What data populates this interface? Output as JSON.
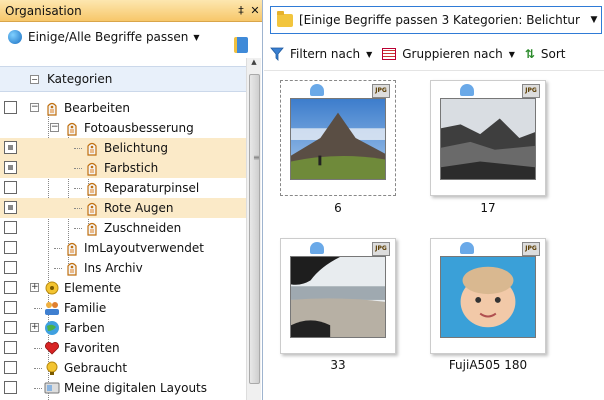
{
  "left_panel": {
    "title": "Organisation",
    "pin_glyph": "‡",
    "close_glyph": "✕",
    "filter_label": "Einige/Alle Begriffe passen",
    "section_header": "Kategorien",
    "tree": [
      {
        "label": "Bearbeiten",
        "checkbox": "unchecked",
        "highlight": false,
        "icon": "category-tag-icon"
      },
      {
        "label": "Fotoausbesserung",
        "checkbox": "none",
        "highlight": false,
        "icon": "category-tag-icon"
      },
      {
        "label": "Belichtung",
        "checkbox": "mixed",
        "highlight": true,
        "icon": "category-tag-icon"
      },
      {
        "label": "Farbstich",
        "checkbox": "mixed",
        "highlight": true,
        "icon": "category-tag-icon"
      },
      {
        "label": "Reparaturpinsel",
        "checkbox": "unchecked",
        "highlight": false,
        "icon": "category-tag-icon"
      },
      {
        "label": "Rote Augen",
        "checkbox": "mixed",
        "highlight": true,
        "icon": "category-tag-icon"
      },
      {
        "label": "Zuschneiden",
        "checkbox": "unchecked",
        "highlight": false,
        "icon": "category-tag-icon"
      },
      {
        "label": "ImLayoutverwendet",
        "checkbox": "unchecked",
        "highlight": false,
        "icon": "category-tag-icon"
      },
      {
        "label": "Ins Archiv",
        "checkbox": "unchecked",
        "highlight": false,
        "icon": "category-tag-icon"
      },
      {
        "label": "Elemente",
        "checkbox": "unchecked",
        "highlight": false,
        "icon": "elements-icon"
      },
      {
        "label": "Familie",
        "checkbox": "unchecked",
        "highlight": false,
        "icon": "family-icon"
      },
      {
        "label": "Farben",
        "checkbox": "unchecked",
        "highlight": false,
        "icon": "colors-globe-icon"
      },
      {
        "label": "Favoriten",
        "checkbox": "unchecked",
        "highlight": false,
        "icon": "heart-icon"
      },
      {
        "label": "Gebraucht",
        "checkbox": "unchecked",
        "highlight": false,
        "icon": "used-icon"
      },
      {
        "label": "Meine digitalen Layouts",
        "checkbox": "unchecked",
        "highlight": false,
        "icon": "layouts-icon"
      }
    ]
  },
  "right_panel": {
    "path_text": "[Einige Begriffe passen 3 Kategorien: Belichtur",
    "toolbar": {
      "filter_label": "Filtern nach",
      "group_label": "Gruppieren nach",
      "sort_label": "Sort"
    },
    "thumbnails": [
      {
        "caption": "6",
        "badge": "JPG",
        "scene": "mountain"
      },
      {
        "caption": "17",
        "badge": "JPG",
        "scene": "rocks"
      },
      {
        "caption": "33",
        "badge": "JPG",
        "scene": "beach"
      },
      {
        "caption": "FujiA505 180",
        "badge": "JPG",
        "scene": "baby"
      }
    ]
  }
}
